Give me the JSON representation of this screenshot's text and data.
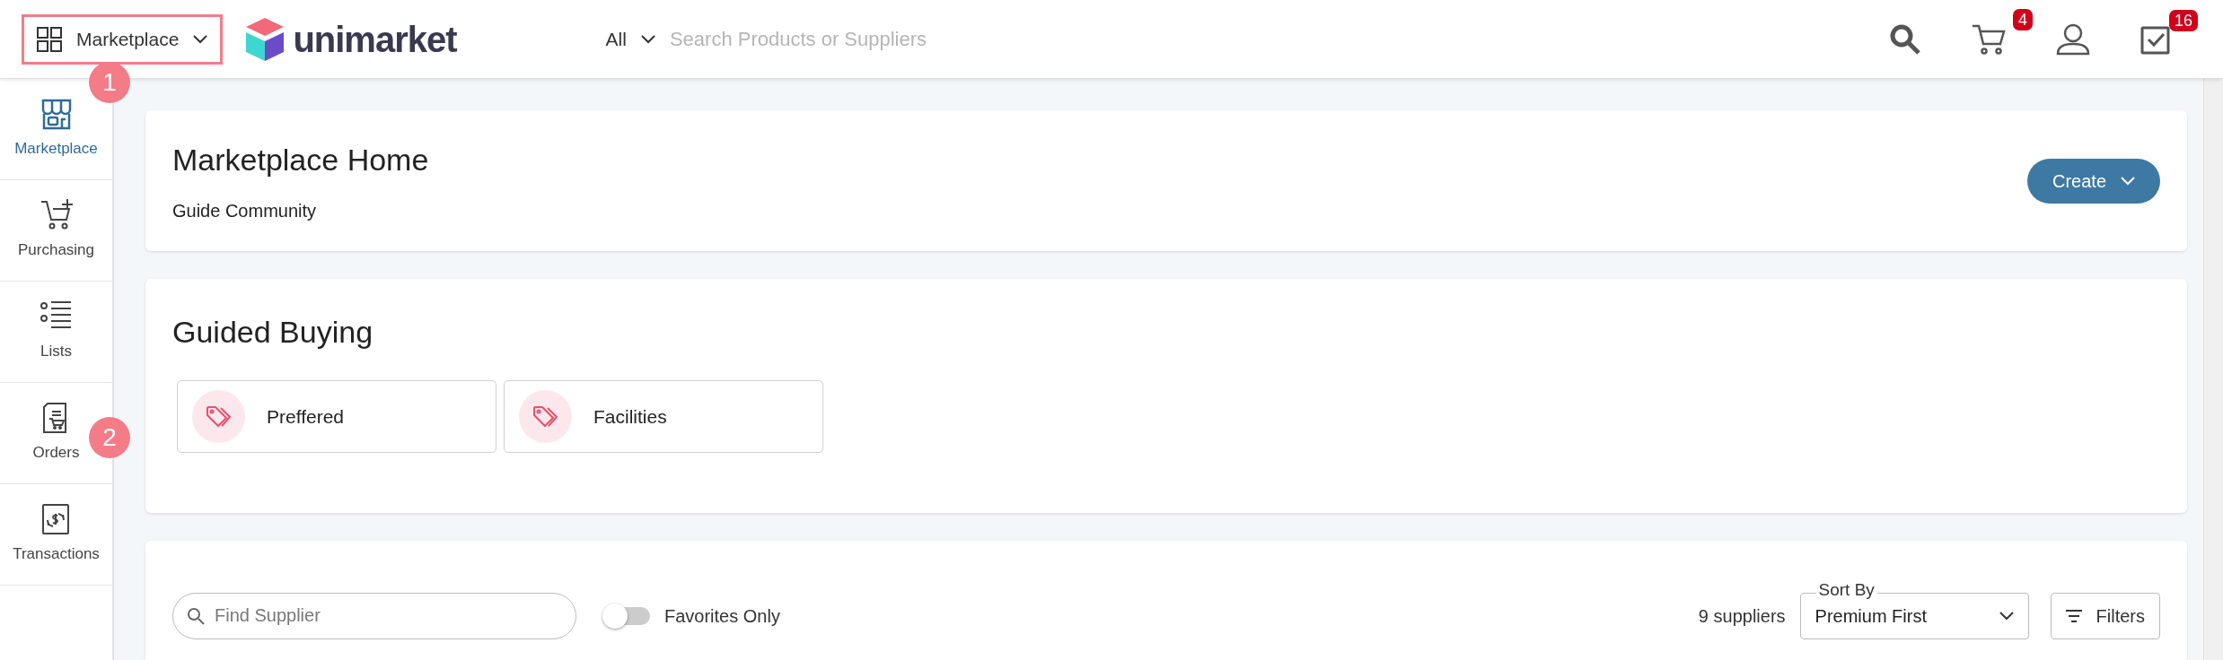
{
  "app_switcher": {
    "label": "Marketplace",
    "highlighted": true
  },
  "logo": {
    "text": "unimarket"
  },
  "search": {
    "scope": "All",
    "placeholder": "Search Products or Suppliers"
  },
  "header_icons": [
    {
      "kind": "search"
    },
    {
      "kind": "cart",
      "badge": "4"
    },
    {
      "kind": "user"
    },
    {
      "kind": "tasks",
      "badge": "16"
    }
  ],
  "sidebar": {
    "items": [
      {
        "kind": "store",
        "label": "Marketplace",
        "selected": true
      },
      {
        "kind": "cart-plus",
        "label": "Purchasing",
        "selected": false
      },
      {
        "kind": "list",
        "label": "Lists",
        "selected": false
      },
      {
        "kind": "order",
        "label": "Orders",
        "selected": false
      },
      {
        "kind": "transaction",
        "label": "Transactions",
        "selected": false
      }
    ]
  },
  "callouts": [
    {
      "label": "1"
    },
    {
      "label": "2"
    }
  ],
  "home_card": {
    "title": "Marketplace Home",
    "subtitle": "Guide Community",
    "create_button": "Create"
  },
  "guided_buying": {
    "title": "Guided Buying",
    "tiles": [
      {
        "label": "Preffered"
      },
      {
        "label": "Facilities"
      }
    ]
  },
  "supplier_bar": {
    "search_placeholder": "Find Supplier",
    "favorites_only": {
      "label": "Favorites Only",
      "on": false
    },
    "count": "9 suppliers",
    "sort": {
      "label": "Sort By",
      "value": "Premium First"
    },
    "filters_button": "Filters"
  }
}
